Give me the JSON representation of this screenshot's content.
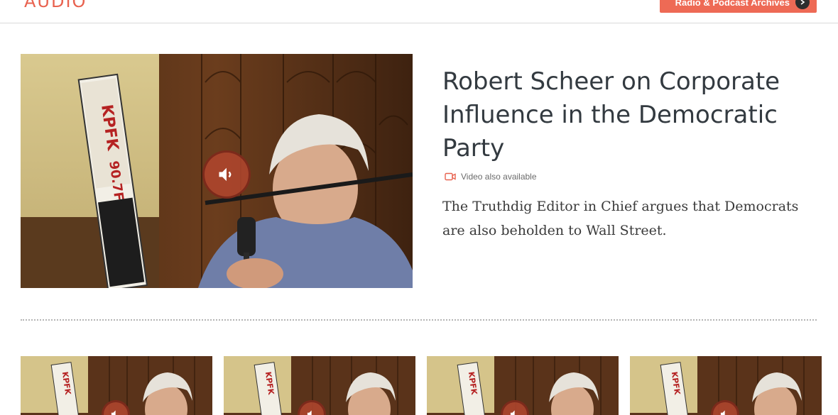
{
  "header": {
    "section_title": "AUDIO",
    "archive_button": "Radio & Podcast Archives"
  },
  "featured": {
    "title": "Robert Scheer on Corporate Influence in the Democratic Party",
    "video_note": "Video also available",
    "description": "The Truthdig Editor in Chief argues that Democrats are also beholden to Wall Street.",
    "image_sign_text": "KPFK 90.7FM"
  },
  "colors": {
    "accent": "#ee6a55",
    "section_title": "#e8624f",
    "play_badge": "#af462d"
  },
  "icons": {
    "play": "speaker-icon",
    "video": "video-camera-icon",
    "arrow": "arrow-right-icon"
  }
}
